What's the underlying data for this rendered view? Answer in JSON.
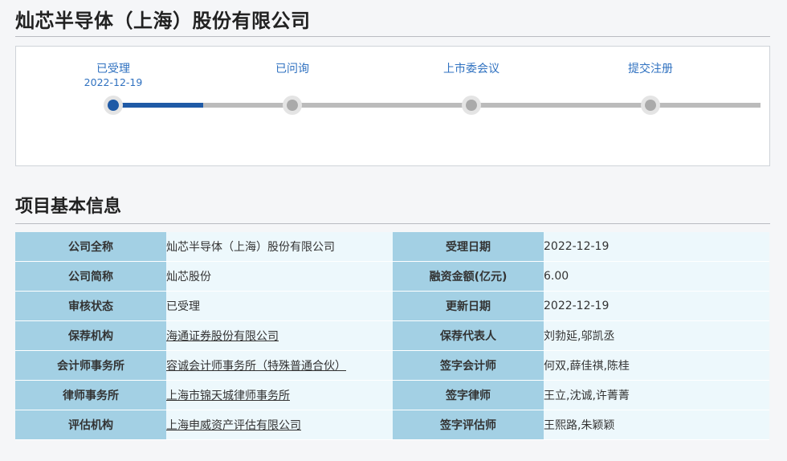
{
  "company_title": "灿芯半导体（上海）股份有限公司",
  "progress": {
    "steps": [
      {
        "label": "已受理",
        "date": "2022-12-19",
        "status": "active"
      },
      {
        "label": "已问询",
        "date": "",
        "status": "pending"
      },
      {
        "label": "上市委会议",
        "date": "",
        "status": "pending"
      },
      {
        "label": "提交注册",
        "date": "",
        "status": "pending"
      }
    ]
  },
  "section": {
    "title": "项目基本信息"
  },
  "rows": [
    {
      "l1": "公司全称",
      "v1": "灿芯半导体（上海）股份有限公司",
      "l2": "受理日期",
      "v2": "2022-12-19"
    },
    {
      "l1": "公司简称",
      "v1": "灿芯股份",
      "l2": "融资金额(亿元)",
      "v2": "6.00"
    },
    {
      "l1": "审核状态",
      "v1": "已受理",
      "l2": "更新日期",
      "v2": "2022-12-19"
    },
    {
      "l1": "保荐机构",
      "v1": "海通证券股份有限公司",
      "l2": "保荐代表人",
      "v2": "刘勃延,邬凯丞"
    },
    {
      "l1": "会计师事务所",
      "v1": "容诚会计师事务所（特殊普通合伙）",
      "l2": "签字会计师",
      "v2": "何双,薛佳祺,陈桂"
    },
    {
      "l1": "律师事务所",
      "v1": "上海市锦天城律师事务所",
      "l2": "签字律师",
      "v2": "王立,沈诚,许菁菁"
    },
    {
      "l1": "评估机构",
      "v1": "上海申威资产评估有限公司",
      "l2": "签字评估师",
      "v2": "王熙路,朱颖颖"
    }
  ]
}
